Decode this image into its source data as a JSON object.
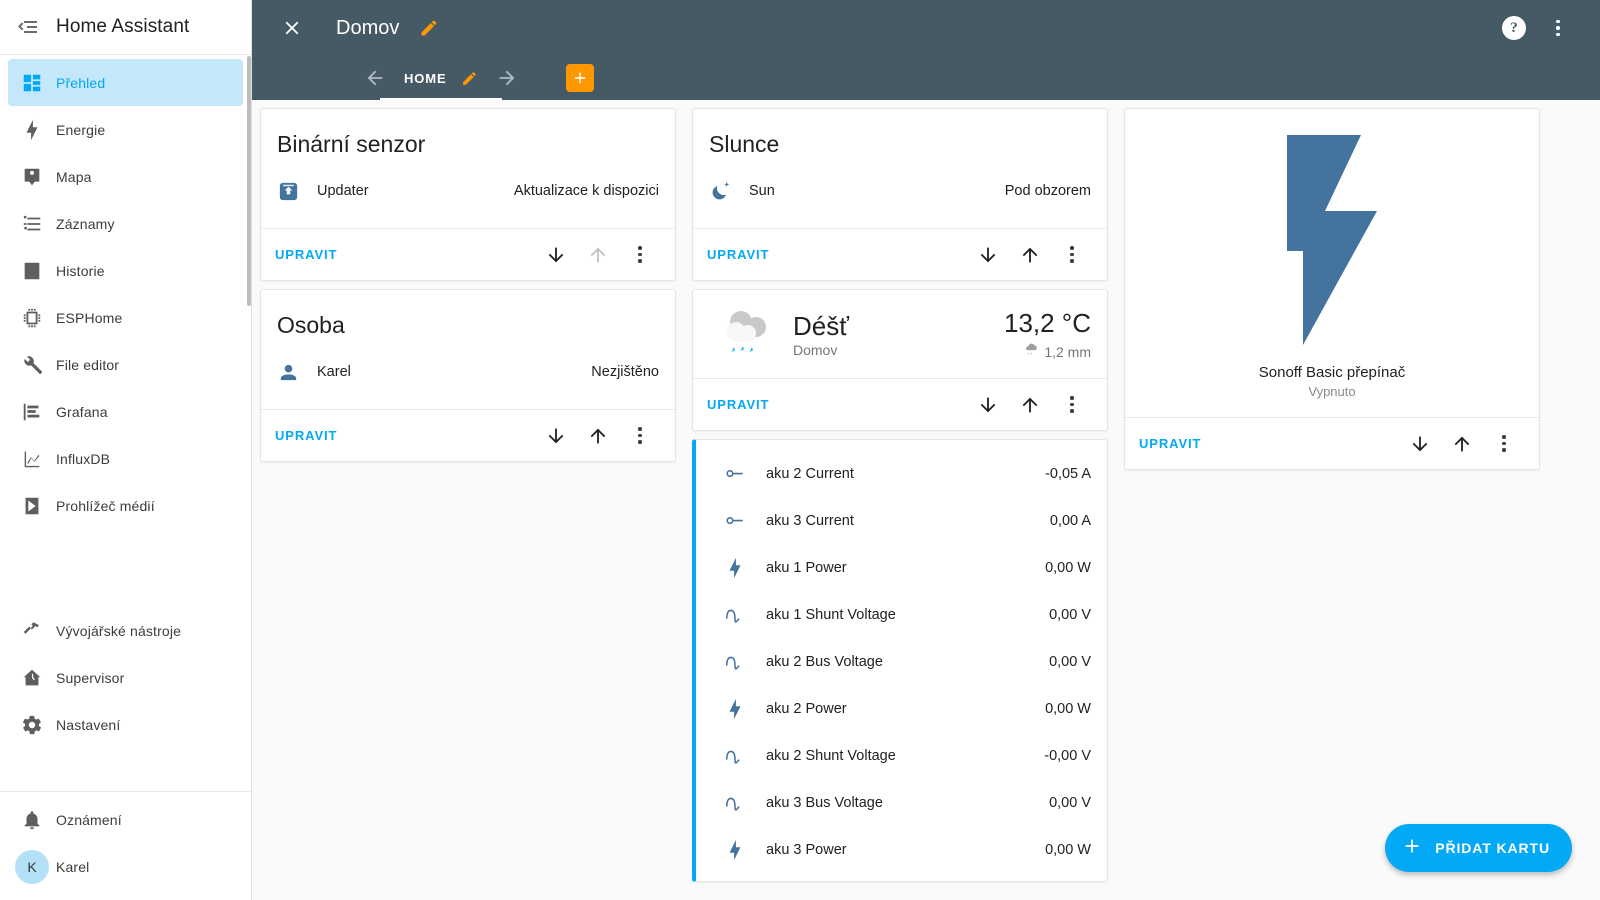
{
  "sidebar": {
    "title": "Home Assistant",
    "hamburger_icon": "menu-open-icon",
    "items": [
      {
        "label": "Přehled",
        "icon": "view-dashboard-icon",
        "active": true
      },
      {
        "label": "Energie",
        "icon": "lightning-bolt-icon",
        "active": false
      },
      {
        "label": "Mapa",
        "icon": "map-marker-account-icon",
        "active": false
      },
      {
        "label": "Záznamy",
        "icon": "format-list-bulleted-icon",
        "active": false
      },
      {
        "label": "Historie",
        "icon": "chart-box-icon",
        "active": false
      },
      {
        "label": "ESPHome",
        "icon": "chip-icon",
        "active": false
      },
      {
        "label": "File editor",
        "icon": "wrench-icon",
        "active": false
      },
      {
        "label": "Grafana",
        "icon": "chart-bar-stacked-icon",
        "active": false
      },
      {
        "label": "InfluxDB",
        "icon": "chart-line-icon",
        "active": false
      },
      {
        "label": "Prohlížeč médií",
        "icon": "play-box-icon",
        "active": false
      }
    ],
    "tools": [
      {
        "label": "Vývojářské nástroje",
        "icon": "hammer-icon"
      },
      {
        "label": "Supervisor",
        "icon": "home-assistant-icon"
      },
      {
        "label": "Nastavení",
        "icon": "cog-icon"
      }
    ],
    "footer": [
      {
        "label": "Oznámení",
        "icon": "bell-icon"
      }
    ],
    "user": {
      "label": "Karel",
      "initial": "K",
      "icon": "avatar"
    }
  },
  "toolbar": {
    "close_icon": "close-icon",
    "view_title": "Domov",
    "edit_title_icon": "pencil-icon",
    "help_icon": "help-circle-icon",
    "overflow_icon": "dots-vertical-icon",
    "tabs": {
      "prev_icon": "arrow-left-icon",
      "next_icon": "arrow-right-icon",
      "add_icon": "plus-icon",
      "items": [
        {
          "label": "HOME",
          "edit_icon": "pencil-icon",
          "active": true
        }
      ]
    },
    "accent_edit": "#ff9800",
    "background": "#455a64"
  },
  "columns": [
    {
      "cards": [
        {
          "type": "entities",
          "title": "Binární senzor",
          "selected": false,
          "rows": [
            {
              "icon": "package-up-icon",
              "name": "Updater",
              "state": "Aktualizace k dispozici"
            }
          ],
          "actions": {
            "edit_label": "UPRAVIT",
            "move_down_icon": "arrow-down-icon",
            "move_up_icon": "arrow-up-icon",
            "move_up_disabled": true,
            "overflow_icon": "dots-vertical-icon"
          }
        },
        {
          "type": "entities",
          "title": "Osoba",
          "selected": false,
          "rows": [
            {
              "icon": "account-icon",
              "name": "Karel",
              "state": "Nezjištěno"
            }
          ],
          "actions": {
            "edit_label": "UPRAVIT",
            "move_down_icon": "arrow-down-icon",
            "move_up_icon": "arrow-up-icon",
            "move_up_disabled": false,
            "overflow_icon": "dots-vertical-icon"
          }
        }
      ]
    },
    {
      "cards": [
        {
          "type": "entities",
          "title": "Slunce",
          "selected": false,
          "rows": [
            {
              "icon": "weather-night-icon",
              "name": "Sun",
              "state": "Pod obzorem"
            }
          ],
          "actions": {
            "edit_label": "UPRAVIT",
            "move_down_icon": "arrow-down-icon",
            "move_up_icon": "arrow-up-icon",
            "move_up_disabled": false,
            "overflow_icon": "dots-vertical-icon"
          }
        },
        {
          "type": "weather",
          "selected": false,
          "icon": "weather-rainy-icon",
          "condition": "Déšť",
          "location": "Domov",
          "temperature": "13,2 °C",
          "precipitation": "1,2 mm",
          "precip_icon": "weather-pouring-icon",
          "actions": {
            "edit_label": "UPRAVIT",
            "move_down_icon": "arrow-down-icon",
            "move_up_icon": "arrow-up-icon",
            "move_up_disabled": false,
            "overflow_icon": "dots-vertical-icon"
          }
        },
        {
          "type": "sensors",
          "selected": true,
          "rows": [
            {
              "icon": "current-ac-icon",
              "name": "aku 2 Current",
              "value": "-0,05 A"
            },
            {
              "icon": "current-ac-icon",
              "name": "aku 3 Current",
              "value": "0,00 A"
            },
            {
              "icon": "flash-icon",
              "name": "aku 1 Power",
              "value": "0,00 W"
            },
            {
              "icon": "sine-wave-icon",
              "name": "aku 1 Shunt Voltage",
              "value": "0,00 V"
            },
            {
              "icon": "sine-wave-icon",
              "name": "aku 2 Bus Voltage",
              "value": "0,00 V"
            },
            {
              "icon": "flash-icon",
              "name": "aku 2 Power",
              "value": "0,00 W"
            },
            {
              "icon": "sine-wave-icon",
              "name": "aku 2 Shunt Voltage",
              "value": "-0,00 V"
            },
            {
              "icon": "sine-wave-icon",
              "name": "aku 3 Bus Voltage",
              "value": "0,00 V"
            },
            {
              "icon": "flash-icon",
              "name": "aku 3 Power",
              "value": "0,00 W"
            }
          ]
        }
      ]
    },
    {
      "cards": [
        {
          "type": "glance",
          "selected": false,
          "icon": "flash-icon",
          "icon_color": "#4a7299",
          "name": "Sonoff Basic přepínač",
          "state": "Vypnuto",
          "actions": {
            "edit_label": "UPRAVIT",
            "move_down_icon": "arrow-down-icon",
            "move_up_icon": "arrow-up-icon",
            "move_up_disabled": false,
            "overflow_icon": "dots-vertical-icon"
          }
        }
      ]
    }
  ],
  "fab": {
    "label": "PŘIDAT KARTU",
    "icon": "plus-icon",
    "color": "#03a9f4"
  }
}
